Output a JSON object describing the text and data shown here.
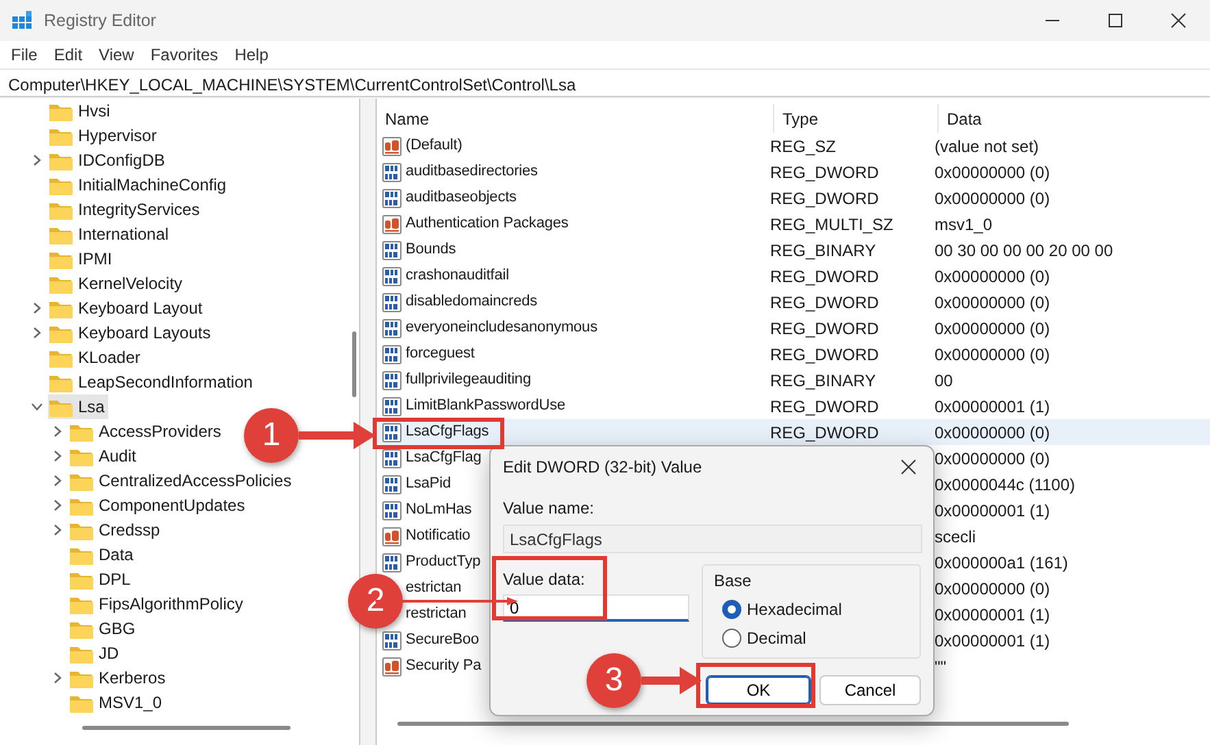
{
  "window": {
    "title": "Registry Editor"
  },
  "menu": [
    "File",
    "Edit",
    "View",
    "Favorites",
    "Help"
  ],
  "address": "Computer\\HKEY_LOCAL_MACHINE\\SYSTEM\\CurrentControlSet\\Control\\Lsa",
  "tree": [
    {
      "label": "Hvsi",
      "expandable": false,
      "selected": false
    },
    {
      "label": "Hypervisor",
      "expandable": false,
      "selected": false
    },
    {
      "label": "IDConfigDB",
      "expandable": true,
      "expanded": false,
      "selected": false
    },
    {
      "label": "InitialMachineConfig",
      "expandable": false,
      "selected": false
    },
    {
      "label": "IntegrityServices",
      "expandable": false,
      "selected": false
    },
    {
      "label": "International",
      "expandable": false,
      "selected": false
    },
    {
      "label": "IPMI",
      "expandable": false,
      "selected": false
    },
    {
      "label": "KernelVelocity",
      "expandable": false,
      "selected": false
    },
    {
      "label": "Keyboard Layout",
      "expandable": true,
      "expanded": false,
      "selected": false
    },
    {
      "label": "Keyboard Layouts",
      "expandable": true,
      "expanded": false,
      "selected": false
    },
    {
      "label": "KLoader",
      "expandable": false,
      "selected": false
    },
    {
      "label": "LeapSecondInformation",
      "expandable": false,
      "selected": false
    },
    {
      "label": "Lsa",
      "expandable": true,
      "expanded": true,
      "selected": true,
      "children": [
        {
          "label": "AccessProviders",
          "expandable": true,
          "expanded": false,
          "selected": false
        },
        {
          "label": "Audit",
          "expandable": true,
          "expanded": false,
          "selected": false
        },
        {
          "label": "CentralizedAccessPolicies",
          "expandable": true,
          "expanded": false,
          "selected": false
        },
        {
          "label": "ComponentUpdates",
          "expandable": true,
          "expanded": false,
          "selected": false
        },
        {
          "label": "Credssp",
          "expandable": true,
          "expanded": false,
          "selected": false
        },
        {
          "label": "Data",
          "expandable": false,
          "selected": false
        },
        {
          "label": "DPL",
          "expandable": false,
          "selected": false
        },
        {
          "label": "FipsAlgorithmPolicy",
          "expandable": false,
          "selected": false
        },
        {
          "label": "GBG",
          "expandable": false,
          "selected": false
        },
        {
          "label": "JD",
          "expandable": false,
          "selected": false
        },
        {
          "label": "Kerberos",
          "expandable": true,
          "expanded": false,
          "selected": false
        },
        {
          "label": "MSV1_0",
          "expandable": false,
          "selected": false
        }
      ]
    }
  ],
  "values": {
    "columns": [
      "Name",
      "Type",
      "Data"
    ],
    "rows": [
      {
        "kind": "string",
        "name": "(Default)",
        "type": "REG_SZ",
        "data": "(value not set)",
        "selected": false
      },
      {
        "kind": "binary",
        "name": "auditbasedirectories",
        "type": "REG_DWORD",
        "data": "0x00000000 (0)",
        "selected": false
      },
      {
        "kind": "binary",
        "name": "auditbaseobjects",
        "type": "REG_DWORD",
        "data": "0x00000000 (0)",
        "selected": false
      },
      {
        "kind": "string",
        "name": "Authentication Packages",
        "type": "REG_MULTI_SZ",
        "data": "msv1_0",
        "selected": false
      },
      {
        "kind": "binary",
        "name": "Bounds",
        "type": "REG_BINARY",
        "data": "00 30 00 00 00 20 00 00",
        "selected": false
      },
      {
        "kind": "binary",
        "name": "crashonauditfail",
        "type": "REG_DWORD",
        "data": "0x00000000 (0)",
        "selected": false
      },
      {
        "kind": "binary",
        "name": "disabledomaincreds",
        "type": "REG_DWORD",
        "data": "0x00000000 (0)",
        "selected": false
      },
      {
        "kind": "binary",
        "name": "everyoneincludesanonymous",
        "type": "REG_DWORD",
        "data": "0x00000000 (0)",
        "selected": false
      },
      {
        "kind": "binary",
        "name": "forceguest",
        "type": "REG_DWORD",
        "data": "0x00000000 (0)",
        "selected": false
      },
      {
        "kind": "binary",
        "name": "fullprivilegeauditing",
        "type": "REG_BINARY",
        "data": "00",
        "selected": false
      },
      {
        "kind": "binary",
        "name": "LimitBlankPasswordUse",
        "type": "REG_DWORD",
        "data": "0x00000001 (1)",
        "selected": false
      },
      {
        "kind": "binary",
        "name": "LsaCfgFlags",
        "type": "REG_DWORD",
        "data": "0x00000000 (0)",
        "selected": true
      },
      {
        "kind": "binary",
        "name": "LsaCfgFlag",
        "data": "0x00000000 (0)",
        "selected": false
      },
      {
        "kind": "binary",
        "name": "LsaPid",
        "data": "0x0000044c (1100)",
        "selected": false
      },
      {
        "kind": "binary",
        "name": "NoLmHas",
        "data": "0x00000001 (1)",
        "selected": false
      },
      {
        "kind": "string",
        "name": "Notificatio",
        "data": "scecli",
        "selected": false
      },
      {
        "kind": "binary",
        "name": "ProductTyp",
        "data": "0x000000a1 (161)",
        "selected": false
      },
      {
        "name": "estrictan",
        "data": "0x00000000 (0)",
        "selected": false
      },
      {
        "name": "restrictan",
        "data": "0x00000001 (1)",
        "selected": false
      },
      {
        "kind": "binary",
        "name": "SecureBoo",
        "data": "0x00000001 (1)",
        "selected": false
      },
      {
        "kind": "string",
        "name": "Security Pa",
        "data": "\"\"",
        "selected": false
      }
    ]
  },
  "dialog": {
    "title": "Edit DWORD (32-bit) Value",
    "value_name_label": "Value name:",
    "value_name": "LsaCfgFlags",
    "value_data_label": "Value data:",
    "value_data": "0",
    "base_label": "Base",
    "base_options": [
      {
        "label": "Hexadecimal",
        "selected": true
      },
      {
        "label": "Decimal",
        "selected": false
      }
    ],
    "buttons": [
      {
        "label": "OK",
        "default": true
      },
      {
        "label": "Cancel",
        "default": false
      }
    ]
  },
  "callouts": [
    {
      "number": "1"
    },
    {
      "number": "2"
    },
    {
      "number": "3"
    }
  ]
}
